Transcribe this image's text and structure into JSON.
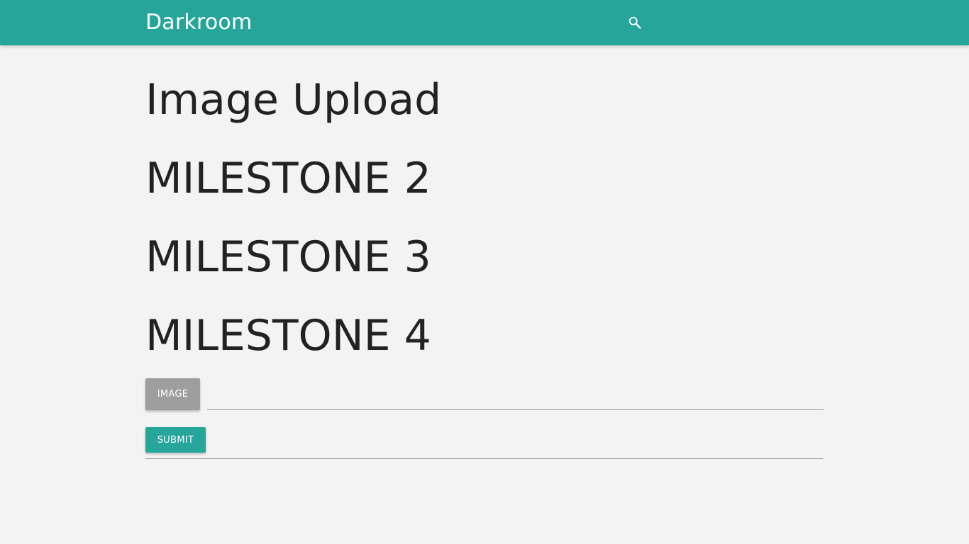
{
  "navbar": {
    "brand": "Darkroom",
    "search_icon": "search-icon",
    "background_color": "#26a69a"
  },
  "main": {
    "title": "Image Upload",
    "milestones": [
      "MILESTONE 2",
      "MILESTONE 3",
      "MILESTONE 4"
    ]
  },
  "upload_form": {
    "image_button_label": "IMAGE",
    "file_path_value": "",
    "submit_label": "SUBMIT"
  },
  "colors": {
    "accent": "#26a69a",
    "image_button": "#9e9e9e",
    "page_background": "#f3f3f3"
  }
}
